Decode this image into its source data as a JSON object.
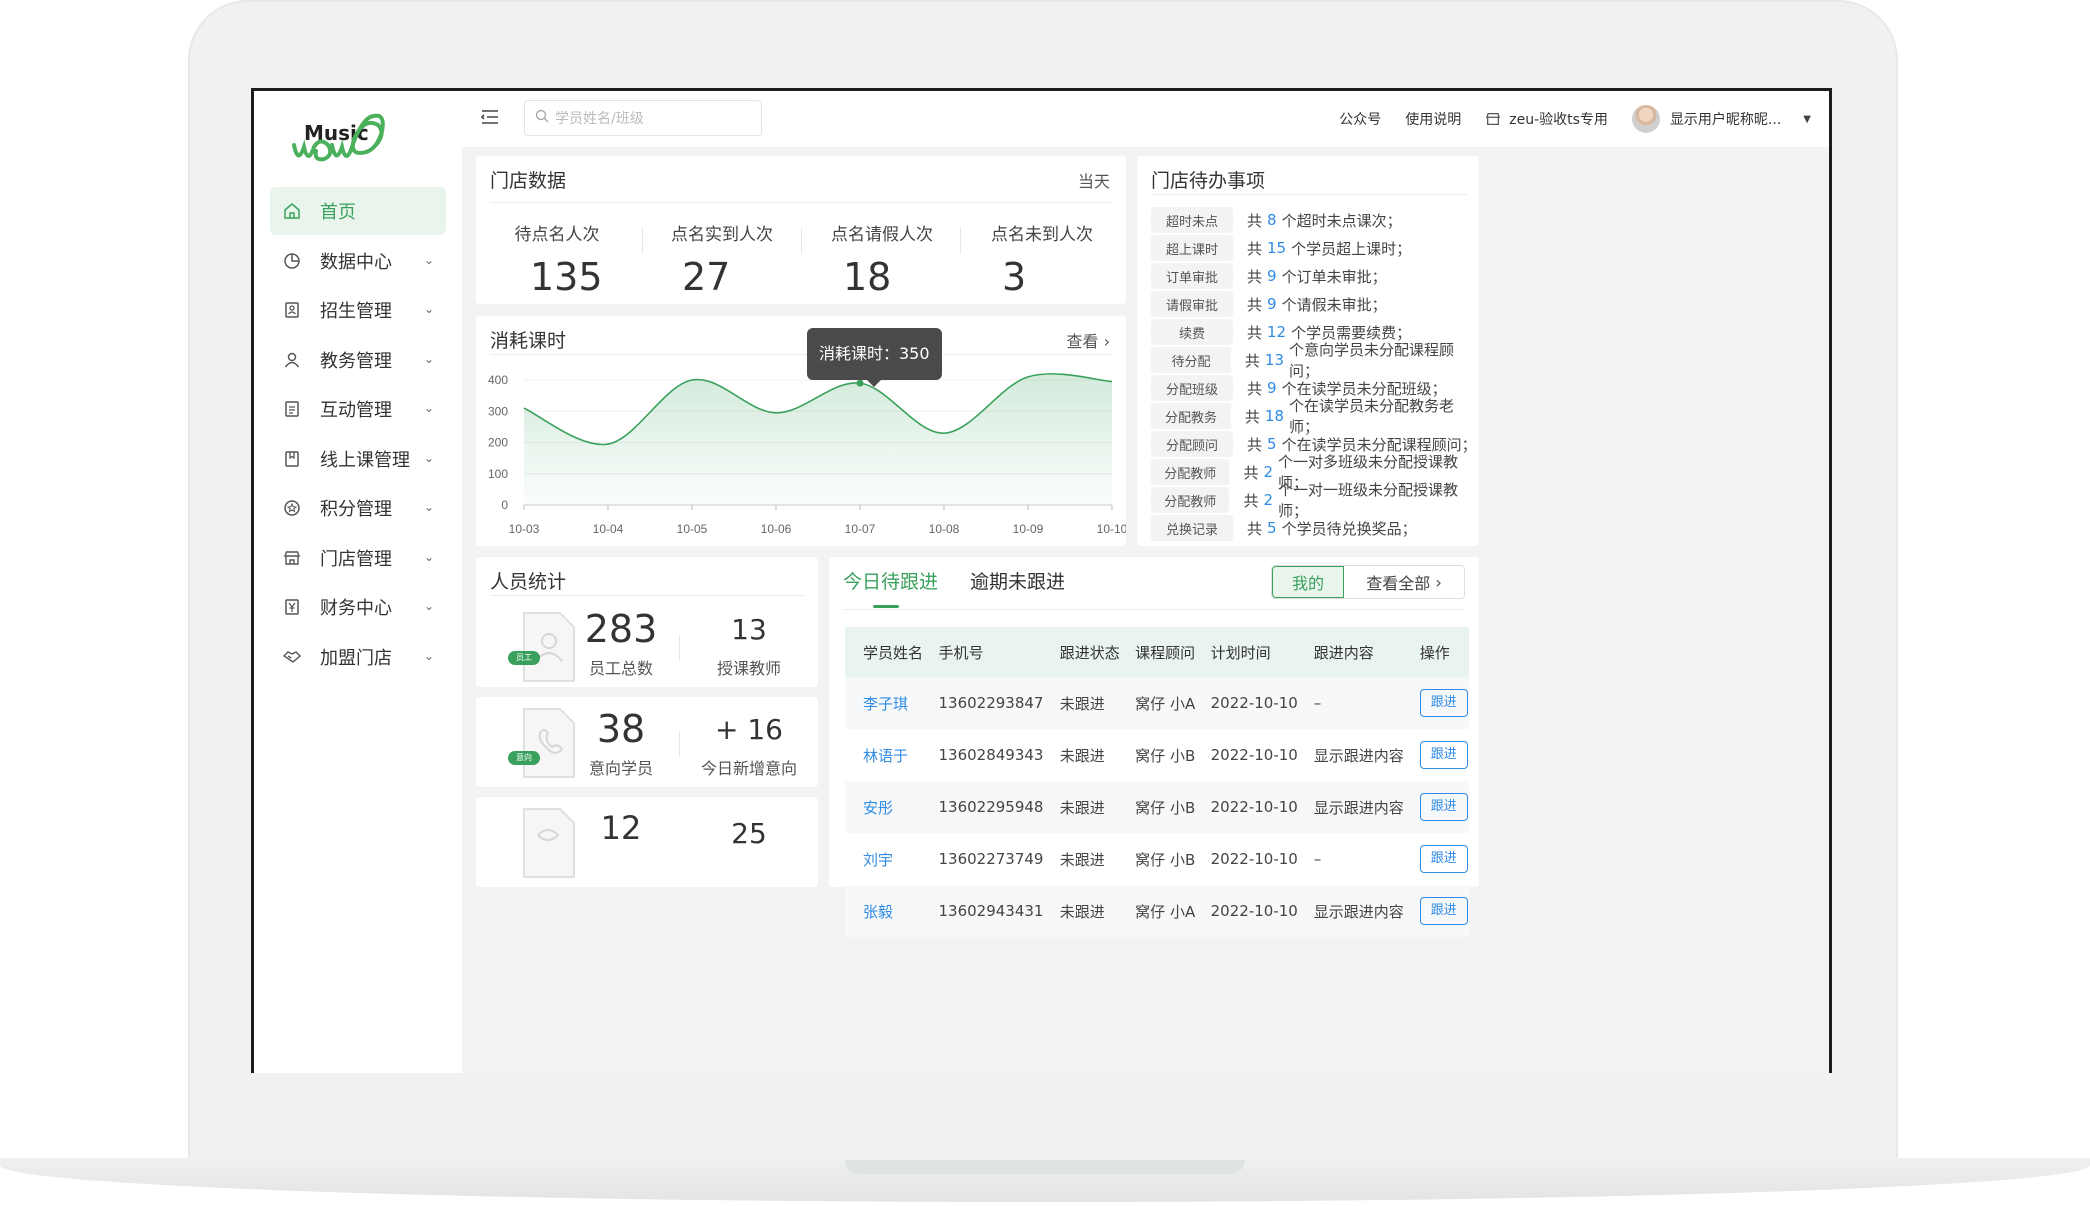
{
  "brand": {
    "logo_top": "Music"
  },
  "sidebar": {
    "items": [
      {
        "label": "首页",
        "icon": "home-icon"
      },
      {
        "label": "数据中心",
        "icon": "pie-chart-icon"
      },
      {
        "label": "招生管理",
        "icon": "contact-card-icon"
      },
      {
        "label": "教务管理",
        "icon": "user-icon"
      },
      {
        "label": "互动管理",
        "icon": "document-icon"
      },
      {
        "label": "线上课管理",
        "icon": "bookmark-icon"
      },
      {
        "label": "积分管理",
        "icon": "star-badge-icon"
      },
      {
        "label": "门店管理",
        "icon": "store-icon"
      },
      {
        "label": "财务中心",
        "icon": "yen-icon"
      },
      {
        "label": "加盟门店",
        "icon": "handshake-icon"
      }
    ]
  },
  "header": {
    "search_placeholder": "学员姓名/班级",
    "links": [
      "公众号",
      "使用说明"
    ],
    "store": "zeu-验收ts专用",
    "user": "显示用户昵称昵..."
  },
  "store_data": {
    "title": "门店数据",
    "period": "当天",
    "stats": [
      {
        "label": "待点名人次",
        "value": "135"
      },
      {
        "label": "点名实到人次",
        "value": "27"
      },
      {
        "label": "点名请假人次",
        "value": "18"
      },
      {
        "label": "点名未到人次",
        "value": "3"
      }
    ]
  },
  "consumption": {
    "title": "消耗课时",
    "action": "查看",
    "tooltip": "消耗课时：350"
  },
  "chart_data": {
    "type": "area",
    "x": [
      "10-03",
      "10-04",
      "10-05",
      "10-06",
      "10-07",
      "10-08",
      "10-09",
      "10-10"
    ],
    "y": [
      310,
      195,
      400,
      295,
      390,
      230,
      410,
      395
    ],
    "ylim": [
      0,
      400
    ],
    "yticks": [
      0,
      100,
      200,
      300,
      400
    ],
    "grid": true,
    "color": "#3aa15c"
  },
  "todo": {
    "title": "门店待办事项",
    "items": [
      {
        "tag": "超时未点",
        "pre": "共",
        "num": "8",
        "post": "个超时未点课次；"
      },
      {
        "tag": "超上课时",
        "pre": "共",
        "num": "15",
        "post": "个学员超上课时；"
      },
      {
        "tag": "订单审批",
        "pre": "共",
        "num": "9",
        "post": "个订单未审批；"
      },
      {
        "tag": "请假审批",
        "pre": "共",
        "num": "9",
        "post": "个请假未审批；"
      },
      {
        "tag": "续费",
        "pre": "共",
        "num": "12",
        "post": "个学员需要续费；"
      },
      {
        "tag": "待分配",
        "pre": "共",
        "num": "13",
        "post": "个意向学员未分配课程顾问；"
      },
      {
        "tag": "分配班级",
        "pre": "共",
        "num": "9",
        "post": "个在读学员未分配班级；"
      },
      {
        "tag": "分配教务",
        "pre": "共",
        "num": "18",
        "post": "个在读学员未分配教务老师；"
      },
      {
        "tag": "分配顾问",
        "pre": "共",
        "num": "5",
        "post": "个在读学员未分配课程顾问；"
      },
      {
        "tag": "分配教师",
        "pre": "共",
        "num": "2",
        "post": "个一对多班级未分配授课教师；"
      },
      {
        "tag": "分配教师",
        "pre": "共",
        "num": "2",
        "post": "个一对一班级未分配授课教师；"
      },
      {
        "tag": "兑换记录",
        "pre": "共",
        "num": "5",
        "post": "个学员待兑换奖品；"
      }
    ]
  },
  "people": {
    "title": "人员统计",
    "staff": {
      "badge": "员工",
      "total": "283",
      "total_label": "员工总数",
      "side": "13",
      "side_label": "授课教师"
    },
    "intent": {
      "badge": "意向",
      "total": "38",
      "total_label": "意向学员",
      "side": "+ 16",
      "side_label": "今日新增意向"
    },
    "third": {
      "total": "12",
      "side": "25"
    }
  },
  "followup": {
    "tabs": [
      "今日待跟进",
      "逾期未跟进"
    ],
    "mine": "我的",
    "view_all": "查看全部",
    "columns": [
      "学员姓名",
      "手机号",
      "跟进状态",
      "课程顾问",
      "计划时间",
      "跟进内容",
      "操作"
    ],
    "rows": [
      {
        "name": "李子琪",
        "phone": "13602293847",
        "status": "未跟进",
        "advisor": "窝仔 小A",
        "date": "2022-10-10",
        "content": "–",
        "op": "跟进"
      },
      {
        "name": "林语于",
        "phone": "13602849343",
        "status": "未跟进",
        "advisor": "窝仔 小B",
        "date": "2022-10-10",
        "content": "显示跟进内容",
        "op": "跟进"
      },
      {
        "name": "安彤",
        "phone": "13602295948",
        "status": "未跟进",
        "advisor": "窝仔 小B",
        "date": "2022-10-10",
        "content": "显示跟进内容",
        "op": "跟进"
      },
      {
        "name": "刘宇",
        "phone": "13602273749",
        "status": "未跟进",
        "advisor": "窝仔 小B",
        "date": "2022-10-10",
        "content": "–",
        "op": "跟进"
      },
      {
        "name": "张毅",
        "phone": "13602943431",
        "status": "未跟进",
        "advisor": "窝仔 小A",
        "date": "2022-10-10",
        "content": "显示跟进内容",
        "op": "跟进"
      }
    ]
  }
}
